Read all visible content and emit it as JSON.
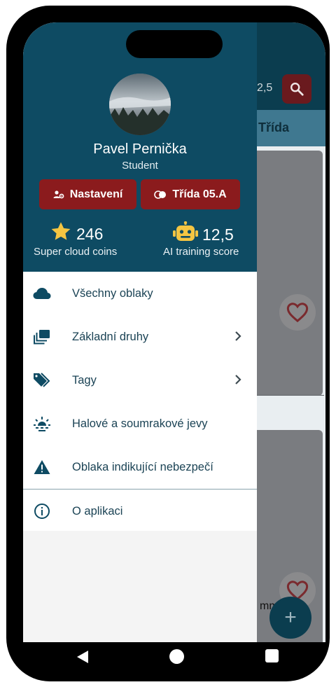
{
  "background_app": {
    "score_partial": "2,5",
    "tab_label": "Třída",
    "card_text_partial": "mm",
    "fab_label": "+"
  },
  "drawer": {
    "user": {
      "name": "Pavel Pernička",
      "role": "Student"
    },
    "buttons": {
      "settings_label": "Nastavení",
      "class_label": "Třída 05.A"
    },
    "stats": {
      "coins_value": "246",
      "coins_label": "Super cloud coins",
      "score_value": "12,5",
      "score_label": "AI training score"
    },
    "menu": [
      {
        "label": "Všechny oblaky",
        "icon": "cloud-icon",
        "has_submenu": false
      },
      {
        "label": "Základní druhy",
        "icon": "collections-icon",
        "has_submenu": true
      },
      {
        "label": "Tagy",
        "icon": "tags-icon",
        "has_submenu": true
      },
      {
        "label": "Halové a soumrakové jevy",
        "icon": "sunset-icon",
        "has_submenu": false
      },
      {
        "label": "Oblaka indikující nebezpečí",
        "icon": "warning-icon",
        "has_submenu": false
      }
    ],
    "about_label": "O aplikaci"
  },
  "colors": {
    "header": "#0e4b63",
    "accent_button": "#8b1b1d",
    "menu_text": "#1b4355"
  }
}
